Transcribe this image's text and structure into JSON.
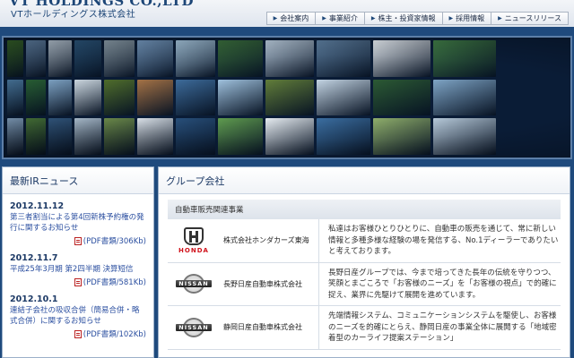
{
  "header": {
    "logo_en": "VT HOLDINGS CO.,LTD",
    "logo_jp": "VTホールディングス株式会社",
    "nav": [
      {
        "label": "会社案内"
      },
      {
        "label": "事業紹介"
      },
      {
        "label": "株主・投資家情報"
      },
      {
        "label": "採用情報"
      },
      {
        "label": "ニュースリリース"
      }
    ]
  },
  "hero": {
    "tile_colors": [
      "#3d6f2e",
      "#6b8fb6",
      "#c9d9e8",
      "#2f5d86",
      "#95a8b5",
      "#7aa0c8",
      "#a8c8e0",
      "#3a6e3c",
      "#b9cbdc",
      "#5c7d9e",
      "#e2e8ee",
      "#3f7a45",
      "#4e7fa8",
      "#2d6a3a",
      "#88b0d4",
      "#d7e3ec",
      "#506e2c",
      "#a47246",
      "#3d6b9a",
      "#9fc1dd",
      "#617d3a",
      "#c3d4e3",
      "#2c5a34",
      "#7ea4c5",
      "#8aa9c8",
      "#4c7b3b",
      "#355c85",
      "#b2c5d6",
      "#6e8d4b",
      "#d8dfe6",
      "#284f7a",
      "#5f9b4f",
      "#e6ecf1",
      "#3b6ea1",
      "#8fae6b",
      "#b6c9d9"
    ]
  },
  "ir_news": {
    "title": "最新IRニュース",
    "items": [
      {
        "date": "2012.11.12",
        "title": "第三者割当による第4回新株予約権の発行に関するお知らせ",
        "pdf": "(PDF書類/306Kb)"
      },
      {
        "date": "2012.11.7",
        "title": "平成25年3月期 第2四半期 決算短信",
        "pdf": "(PDF書類/581Kb)"
      },
      {
        "date": "2012.10.1",
        "title": "連結子会社の吸収合併（簡易合併・略式合併）に関するお知らせ",
        "pdf": "(PDF書類/102Kb)"
      }
    ]
  },
  "group": {
    "title": "グループ会社",
    "section": "自動車販売関連事業",
    "companies": [
      {
        "logo": "HONDA",
        "logo_icon": "honda-logo-icon",
        "name": "株式会社ホンダカーズ東海",
        "desc": "私達はお客様ひとりひとりに、自動車の販売を通じて、常に新しい情報と多種多様な経験の場を発信する、No.1ディーラーでありたいと考えております。"
      },
      {
        "logo": "NISSAN",
        "logo_icon": "nissan-logo-icon",
        "name": "長野日産自動車株式会社",
        "desc": "長野日産グループでは、今まで培ってきた長年の伝統を守りつつ、笑顔とまごころで「お客様のニーズ」を「お客様の視点」で的確に捉え、業界に先駆けて展開を進めています。"
      },
      {
        "logo": "NISSAN",
        "logo_icon": "nissan-logo-icon",
        "name": "静岡日産自動車株式会社",
        "desc": "先端情報システム、コミュニケーションシステムを駆使し、お客様のニーズを的確にとらえ、静岡日産の事業全体に展開する「地域密着型のカーライフ提案ステーション」"
      }
    ]
  }
}
